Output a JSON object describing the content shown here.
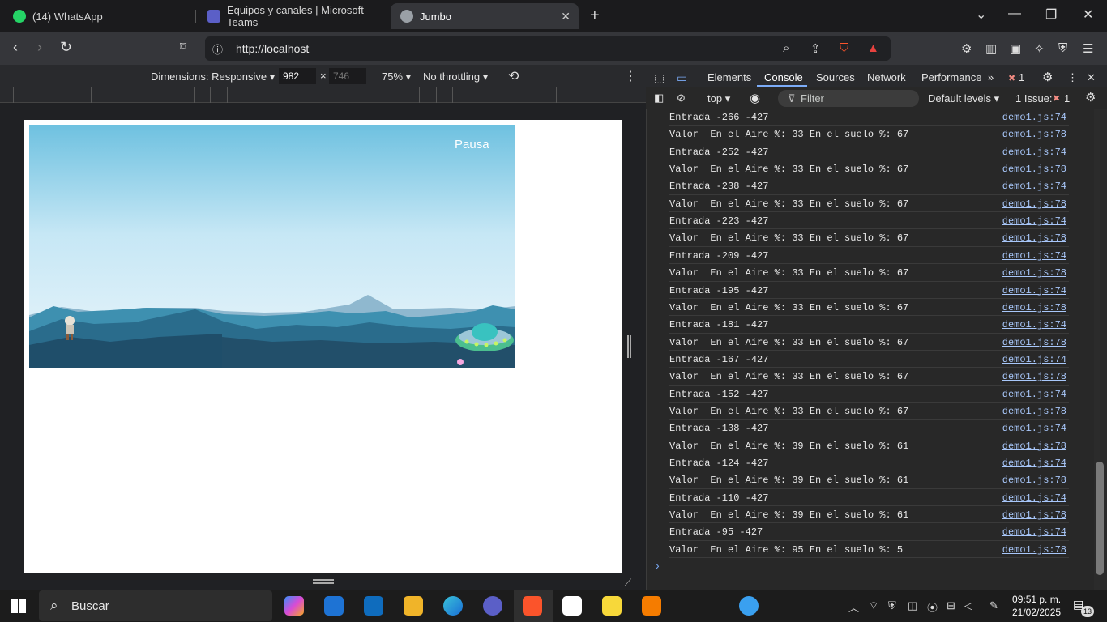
{
  "tabs": [
    {
      "label": "(14) WhatsApp",
      "badge": "14",
      "icon": "whatsapp-icon",
      "color": "#25d366"
    },
    {
      "label": "Equipos y canales | Microsoft Teams",
      "icon": "teams-icon",
      "color": "#5b5fc7"
    },
    {
      "label": "Jumbo",
      "icon": "globe-icon",
      "color": "#9aa0a6"
    }
  ],
  "address": {
    "url": "http://localhost"
  },
  "device_toolbar": {
    "dimensions_label": "Dimensions: Responsive",
    "width": "982",
    "height": "746",
    "zoom": "75%",
    "throttling": "No throttling"
  },
  "game": {
    "pause_label": "Pausa"
  },
  "devtools": {
    "tabs": [
      "Elements",
      "Console",
      "Sources",
      "Network",
      "Performance"
    ],
    "active_tab": "Console",
    "error_count": "1",
    "context": "top",
    "filter_placeholder": "Filter",
    "levels": "Default levels",
    "issues_label": "1 Issue:",
    "issues_count": "1"
  },
  "console_rows": [
    {
      "msg": "Entrada -266 -427",
      "src": "demo1.js:74"
    },
    {
      "msg": "Valor  En el Aire %: 33 En el suelo %: 67",
      "src": "demo1.js:78"
    },
    {
      "msg": "Entrada -252 -427",
      "src": "demo1.js:74"
    },
    {
      "msg": "Valor  En el Aire %: 33 En el suelo %: 67",
      "src": "demo1.js:78"
    },
    {
      "msg": "Entrada -238 -427",
      "src": "demo1.js:74"
    },
    {
      "msg": "Valor  En el Aire %: 33 En el suelo %: 67",
      "src": "demo1.js:78"
    },
    {
      "msg": "Entrada -223 -427",
      "src": "demo1.js:74"
    },
    {
      "msg": "Valor  En el Aire %: 33 En el suelo %: 67",
      "src": "demo1.js:78"
    },
    {
      "msg": "Entrada -209 -427",
      "src": "demo1.js:74"
    },
    {
      "msg": "Valor  En el Aire %: 33 En el suelo %: 67",
      "src": "demo1.js:78"
    },
    {
      "msg": "Entrada -195 -427",
      "src": "demo1.js:74"
    },
    {
      "msg": "Valor  En el Aire %: 33 En el suelo %: 67",
      "src": "demo1.js:78"
    },
    {
      "msg": "Entrada -181 -427",
      "src": "demo1.js:74"
    },
    {
      "msg": "Valor  En el Aire %: 33 En el suelo %: 67",
      "src": "demo1.js:78"
    },
    {
      "msg": "Entrada -167 -427",
      "src": "demo1.js:74"
    },
    {
      "msg": "Valor  En el Aire %: 33 En el suelo %: 67",
      "src": "demo1.js:78"
    },
    {
      "msg": "Entrada -152 -427",
      "src": "demo1.js:74"
    },
    {
      "msg": "Valor  En el Aire %: 33 En el suelo %: 67",
      "src": "demo1.js:78"
    },
    {
      "msg": "Entrada -138 -427",
      "src": "demo1.js:74"
    },
    {
      "msg": "Valor  En el Aire %: 39 En el suelo %: 61",
      "src": "demo1.js:78"
    },
    {
      "msg": "Entrada -124 -427",
      "src": "demo1.js:74"
    },
    {
      "msg": "Valor  En el Aire %: 39 En el suelo %: 61",
      "src": "demo1.js:78"
    },
    {
      "msg": "Entrada -110 -427",
      "src": "demo1.js:74"
    },
    {
      "msg": "Valor  En el Aire %: 39 En el suelo %: 61",
      "src": "demo1.js:78"
    },
    {
      "msg": "Entrada -95 -427",
      "src": "demo1.js:74"
    },
    {
      "msg": "Valor  En el Aire %: 95 En el suelo %: 5",
      "src": "demo1.js:78"
    }
  ],
  "taskbar": {
    "search_placeholder": "Buscar",
    "time": "09:51 p. m.",
    "date": "21/02/2025",
    "notifications": "13"
  }
}
